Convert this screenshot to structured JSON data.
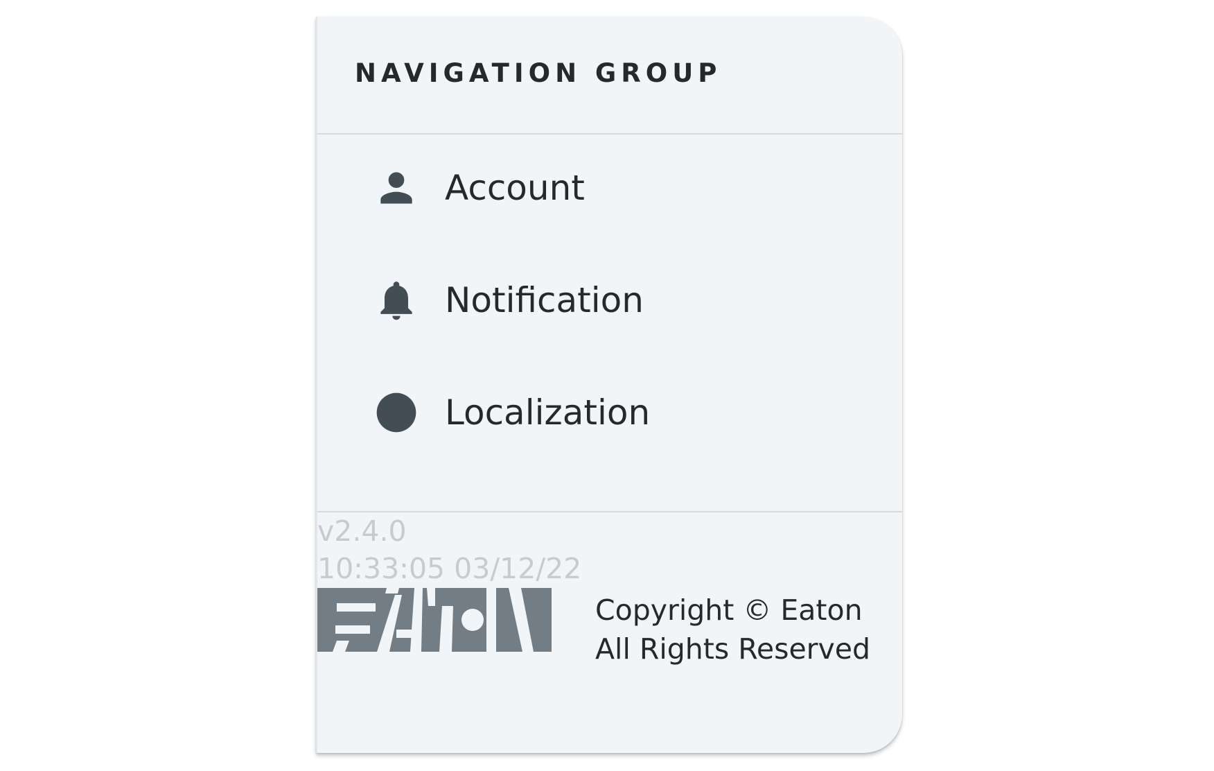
{
  "drawer": {
    "group_title": "NAVIGATION GROUP",
    "items": [
      {
        "label": "Account",
        "icon": "person-icon"
      },
      {
        "label": "Notification",
        "icon": "bell-icon"
      },
      {
        "label": "Localization",
        "icon": "circle-icon"
      }
    ],
    "footer": {
      "version": "v2.4.0",
      "build_time": "10:33:05 03/12/22",
      "logo": "EATON",
      "copyright_line1": "Copyright © Eaton",
      "copyright_line2": "All Rights Reserved"
    }
  },
  "colors": {
    "drawer_background": "#f2f5f8",
    "text_primary": "#25292c",
    "icon": "#424e54",
    "muted_text": "#c7cbce",
    "logo_gray": "#737d85",
    "divider": "#d7dbde"
  }
}
